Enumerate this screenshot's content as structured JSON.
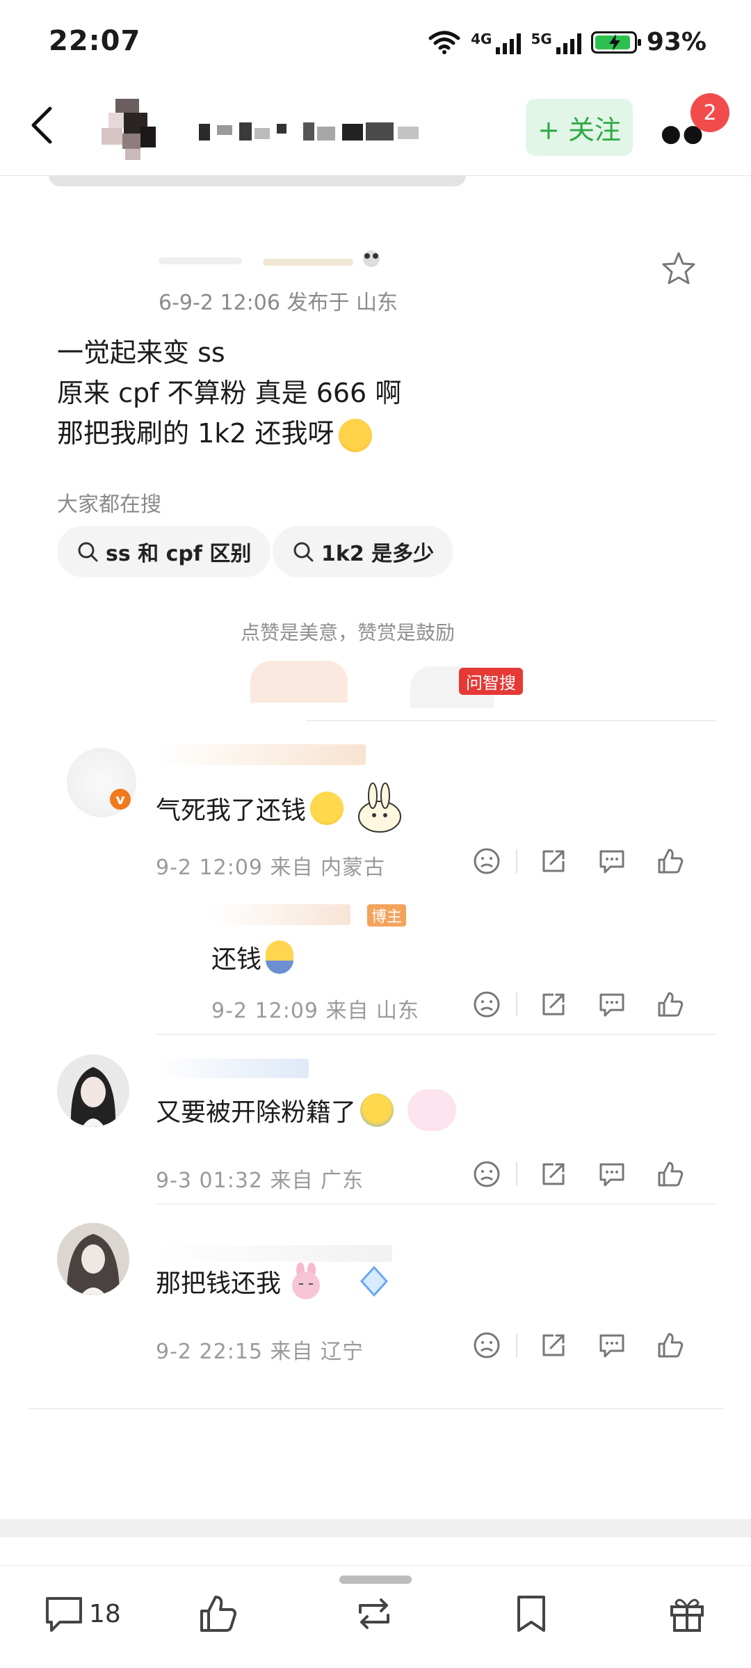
{
  "status_bar": {
    "time": "22:07",
    "network_a": "4G",
    "network_b": "5G",
    "battery": "93%",
    "battery_level": 0.93
  },
  "nav": {
    "follow_label": "+ 关注",
    "notification_count": "2"
  },
  "post": {
    "meta": "6-9-2 12:06  发布于 山东",
    "lines": [
      "一觉起来变 ss",
      "原来 cpf 不算粉 真是 666 啊",
      "那把我刷的 1k2 还我呀"
    ],
    "search_hint": "大家都在搜",
    "search_chips": [
      "ss 和 cpf 区别",
      "1k2 是多少"
    ],
    "praise_text": "点赞是美意，赞赏是鼓励",
    "ask_badge": "问智搜"
  },
  "comments": [
    {
      "text": "气死我了还钱",
      "meta": "9-2 12:09  来自 内蒙古"
    },
    {
      "reply_badge": "博主",
      "text": "还钱",
      "meta": "9-2 12:09  来自 山东"
    },
    {
      "text": "又要被开除粉籍了",
      "meta": "9-3 01:32  来自 广东"
    },
    {
      "text": "那把钱还我",
      "meta": "9-2 22:15  来自 辽宁"
    }
  ],
  "bottom_bar": {
    "comment_count": "18"
  },
  "colors": {
    "accent_green": "#2fa944",
    "follow_bg": "#e2f6e8",
    "badge_red": "#f24b4b"
  }
}
